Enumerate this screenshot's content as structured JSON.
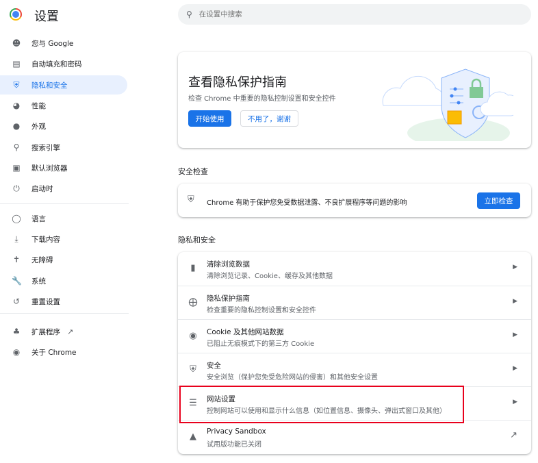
{
  "app": {
    "title": "设置"
  },
  "search": {
    "placeholder": "在设置中搜索"
  },
  "sidebar": {
    "items": [
      {
        "label": "您与 Google",
        "icon": "person-icon"
      },
      {
        "label": "自动填充和密码",
        "icon": "clipboard-icon"
      },
      {
        "label": "隐私和安全",
        "icon": "shield-icon",
        "active": true
      },
      {
        "label": "性能",
        "icon": "speedometer-icon"
      },
      {
        "label": "外观",
        "icon": "palette-icon"
      },
      {
        "label": "搜索引擎",
        "icon": "search-icon"
      },
      {
        "label": "默认浏览器",
        "icon": "browser-icon"
      },
      {
        "label": "启动时",
        "icon": "power-icon"
      },
      {
        "label": "语言",
        "icon": "globe-icon"
      },
      {
        "label": "下载内容",
        "icon": "download-icon"
      },
      {
        "label": "无障碍",
        "icon": "accessibility-icon"
      },
      {
        "label": "系统",
        "icon": "wrench-icon"
      },
      {
        "label": "重置设置",
        "icon": "history-icon"
      },
      {
        "label": "扩展程序",
        "icon": "puzzle-icon"
      },
      {
        "label": "关于 Chrome",
        "icon": "chrome-icon"
      }
    ]
  },
  "guide_card": {
    "title": "查看隐私保护指南",
    "subtitle": "检查 Chrome 中重要的隐私控制设置和安全控件",
    "start_button": "开始使用",
    "dismiss_button": "不用了，谢谢"
  },
  "safety_check": {
    "heading": "安全检查",
    "text": "Chrome 有助于保护您免受数据泄露、不良扩展程序等问题的影响",
    "button": "立即检查"
  },
  "privacy": {
    "heading": "隐私和安全",
    "rows": [
      {
        "title": "清除浏览数据",
        "desc": "清除浏览记录、Cookie、缓存及其他数据",
        "icon": "trash-icon"
      },
      {
        "title": "隐私保护指南",
        "desc": "检查重要的隐私控制设置和安全控件",
        "icon": "compass-icon"
      },
      {
        "title": "Cookie 及其他网站数据",
        "desc": "已阻止无痕模式下的第三方 Cookie",
        "icon": "cookie-icon"
      },
      {
        "title": "安全",
        "desc": "安全浏览（保护您免受危险网站的侵害）和其他安全设置",
        "icon": "shield-icon"
      },
      {
        "title": "网站设置",
        "desc": "控制网站可以使用和显示什么信息（如位置信息、摄像头、弹出式窗口及其他）",
        "icon": "sliders-icon",
        "highlighted": true
      },
      {
        "title": "Privacy Sandbox",
        "desc": "试用版功能已关闭",
        "icon": "flask-icon"
      }
    ]
  },
  "colors": {
    "accent": "#1a73e8",
    "highlight_box": "#e8001c",
    "active_nav_bg": "#e8f0fe"
  }
}
